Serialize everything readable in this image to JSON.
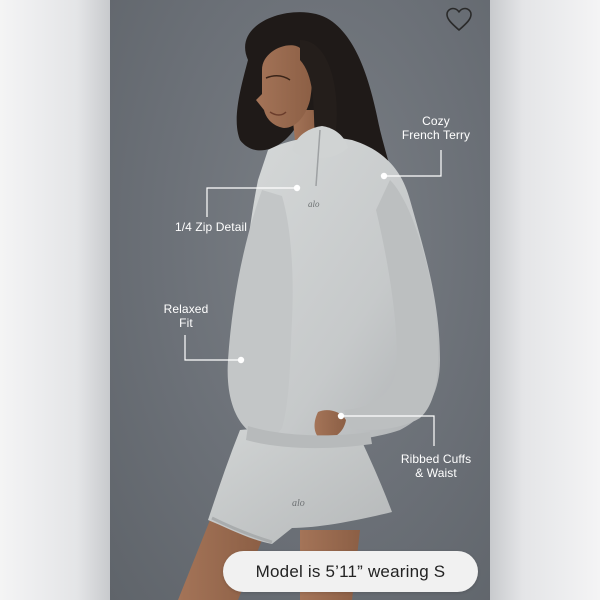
{
  "product_image": {
    "background_color": "#6b7076",
    "garment_color": "#c9cccc"
  },
  "wishlist": {
    "icon": "heart-outline-icon"
  },
  "callouts": {
    "cozy": "Cozy\nFrench Terry",
    "zip": "1/4 Zip Detail",
    "relaxed": "Relaxed\nFit",
    "ribbed": "Ribbed Cuffs\n& Waist"
  },
  "logo_text": "alo",
  "size_info": {
    "text": "Model is 5’11” wearing S"
  }
}
